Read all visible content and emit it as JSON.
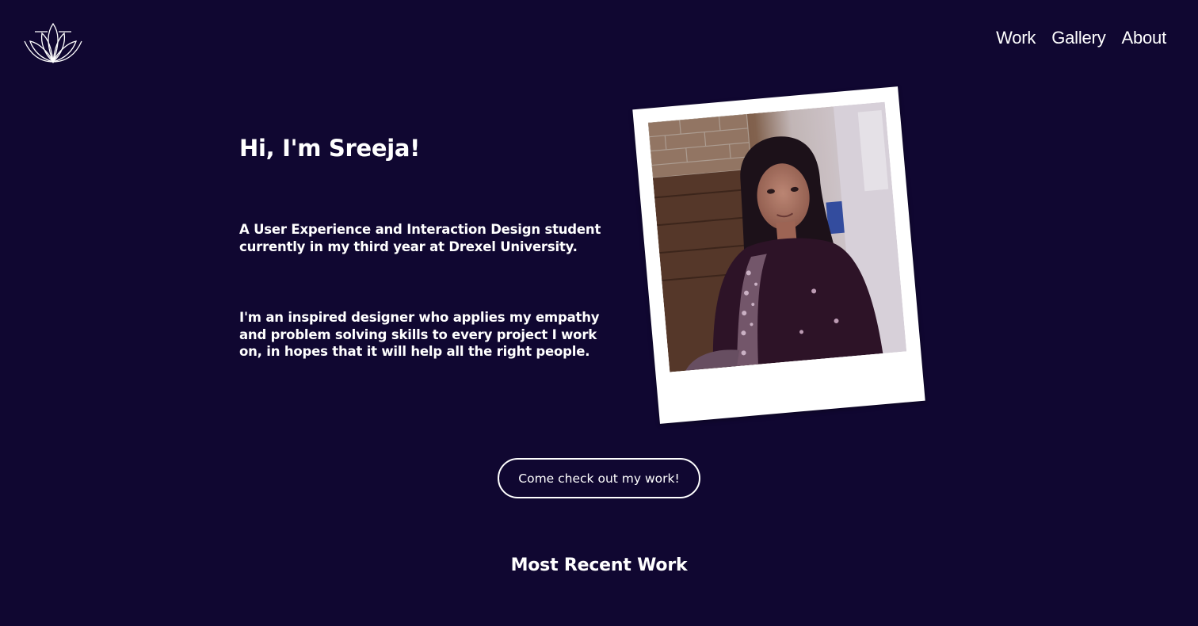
{
  "nav": {
    "items": [
      {
        "label": "Work"
      },
      {
        "label": "Gallery"
      },
      {
        "label": "About"
      }
    ]
  },
  "hero": {
    "title": "Hi, I'm Sreeja!",
    "paragraph1": "A User Experience and Interaction Design student currently in my third year at Drexel University.",
    "paragraph2": "I'm an inspired designer who applies my empathy and problem solving skills to every project I work on, in hopes that it will help all the right people."
  },
  "cta": {
    "label": "Come check out my work!"
  },
  "recent": {
    "title": "Most Recent Work"
  },
  "colors": {
    "background": "#100731",
    "text": "#ffffff",
    "polaroid": "#ffffff"
  },
  "icons": {
    "logo": "lotus-icon"
  }
}
